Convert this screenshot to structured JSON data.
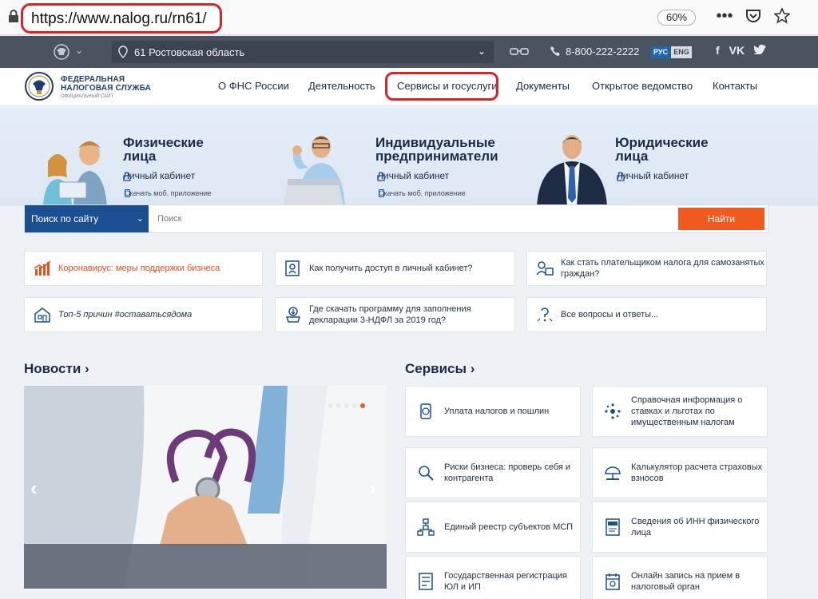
{
  "browser": {
    "url": "https://www.nalog.ru/rn61/",
    "zoom": "60%",
    "menu_glyph": "•••"
  },
  "topbar": {
    "region": "61 Ростовская область",
    "phone": "8-800-222-2222",
    "lang_ru": "РУС",
    "lang_en": "ENG",
    "social": [
      "f",
      "VK",
      "tw"
    ]
  },
  "logo": {
    "line1": "ФЕДЕРАЛЬНАЯ",
    "line2": "НАЛОГОВАЯ СЛУЖБА",
    "line3": "ОФИЦИАЛЬНЫЙ САЙТ"
  },
  "nav": {
    "items": [
      "О ФНС России",
      "Деятельность",
      "Сервисы и госуслуги",
      "Документы",
      "Открытое ведомство",
      "Контакты"
    ]
  },
  "hero": {
    "personas": [
      {
        "title1": "Физические",
        "title2": "лица",
        "cabinet": "Личный кабинет",
        "app": "Скачать моб. приложение"
      },
      {
        "title1": "Индивидуальные",
        "title2": "предприниматели",
        "cabinet": "Личный кабинет",
        "app": "Скачать моб. приложение"
      },
      {
        "title1": "Юридические",
        "title2": "лица",
        "cabinet": "Личный кабинет"
      }
    ]
  },
  "search": {
    "scope": "Поиск по сайту",
    "placeholder": "Поиск",
    "button": "Найти"
  },
  "quick_links": [
    {
      "label": "Коронавирус: меры поддержки бизнеса",
      "icon": "chart-icon"
    },
    {
      "label": "Как получить доступ в личный кабинет?",
      "icon": "cabinet-icon"
    },
    {
      "label": "Как стать плательщиком налога для самозанятых граждан?",
      "icon": "selfemployed-icon"
    },
    {
      "label": "Топ-5 причин #оставатьсядома",
      "icon": "house-icon"
    },
    {
      "label": "Где скачать программу для заполнения декларации 3-НДФЛ за 2019 год?",
      "icon": "download-icon"
    },
    {
      "label": "Все вопросы и ответы...",
      "icon": "question-icon"
    }
  ],
  "news": {
    "title": "Новости ›"
  },
  "services": {
    "title": "Сервисы ›",
    "items": [
      "Уплата налогов и пошлин",
      "Справочная информация о ставках и льготах по имущественным налогам",
      "Риски бизнеса: проверь себя и контрагента",
      "Калькулятор расчета страховых взносов",
      "Единый реестр субъектов МСП",
      "Сведения об ИНН физического лица",
      "Государственная регистрация ЮЛ и ИП",
      "Онлайн запись на прием в налоговый орган"
    ]
  },
  "colors": {
    "accent_orange": "#f05a1e",
    "brand_blue": "#1c4f92",
    "topbar": "#4a5461",
    "highlight_red": "#d8232a"
  }
}
